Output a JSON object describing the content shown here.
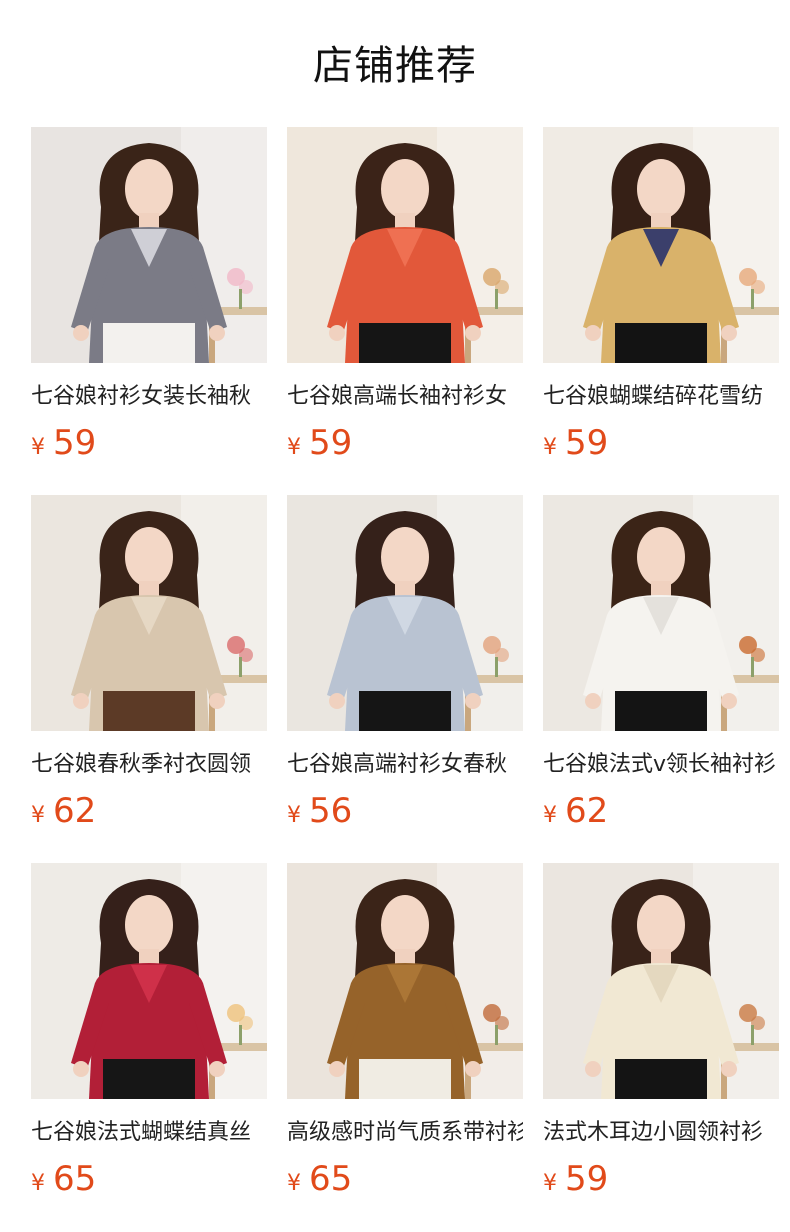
{
  "page_title": "店铺推荐",
  "currency": "¥",
  "colors": {
    "price": "#e14a1a",
    "title": "#111111"
  },
  "products": [
    {
      "name": "七谷娘衬衫女装长袖秋",
      "price": "59",
      "image": "woman-in-gray-floral-bow-blouse",
      "wall": "#e8e4e1",
      "hair": "#3a2418",
      "top": "#7b7b86",
      "top2": "#cfcfd6",
      "bottom": "#f3f1ee",
      "accent": "#f1b8c8"
    },
    {
      "name": "七谷娘高端长袖衬衫女",
      "price": "59",
      "image": "woman-in-orange-blouse",
      "wall": "#efe7dc",
      "hair": "#3b2318",
      "top": "#e2583a",
      "top2": "#ef7052",
      "bottom": "#151515",
      "accent": "#d9a66a"
    },
    {
      "name": "七谷娘蝴蝶结碎花雪纺",
      "price": "59",
      "image": "woman-in-polka-dot-bow-blouse",
      "wall": "#f0ebe4",
      "hair": "#362016",
      "top": "#d9b26a",
      "top2": "#3b3f6b",
      "bottom": "#131313",
      "accent": "#e7a97a"
    },
    {
      "name": "七谷娘春秋季衬衣圆领",
      "price": "62",
      "image": "woman-in-beige-blouse",
      "wall": "#ebe6df",
      "hair": "#3a2419",
      "top": "#d8c6ae",
      "top2": "#e6d8c4",
      "bottom": "#5c3a26",
      "accent": "#d96b6b"
    },
    {
      "name": "七谷娘高端衬衫女春秋",
      "price": "56",
      "image": "woman-in-light-blue-shirt",
      "wall": "#eae6e0",
      "hair": "#35211a",
      "top": "#b9c3d2",
      "top2": "#d0d8e3",
      "bottom": "#151515",
      "accent": "#e3a27d"
    },
    {
      "name": "七谷娘法式v领长袖衬衫",
      "price": "62",
      "image": "woman-in-white-v-neck-blouse",
      "wall": "#ece8e2",
      "hair": "#3b2417",
      "top": "#f5f3ef",
      "top2": "#e4e1dc",
      "bottom": "#141414",
      "accent": "#c96a2e"
    },
    {
      "name": "七谷娘法式蝴蝶结真丝",
      "price": "65",
      "image": "woman-in-red-bow-blouse",
      "wall": "#eeebe6",
      "hair": "#35201a",
      "top": "#b21f37",
      "top2": "#cf3049",
      "bottom": "#161616",
      "accent": "#efc27c"
    },
    {
      "name": "高级感时尚气质系带衬衫",
      "price": "65",
      "image": "woman-in-brown-tie-blouse",
      "wall": "#ebe4dc",
      "hair": "#3b2418",
      "top": "#96632a",
      "top2": "#ab7636",
      "bottom": "#f0ece3",
      "accent": "#c06a3a"
    },
    {
      "name": "法式木耳边小圆领衬衫",
      "price": "59",
      "image": "woman-in-cream-ruffle-blouse",
      "wall": "#ebe6e0",
      "hair": "#392319",
      "top": "#f1e8d3",
      "top2": "#e4d8bf",
      "bottom": "#141414",
      "accent": "#c97a44"
    }
  ]
}
